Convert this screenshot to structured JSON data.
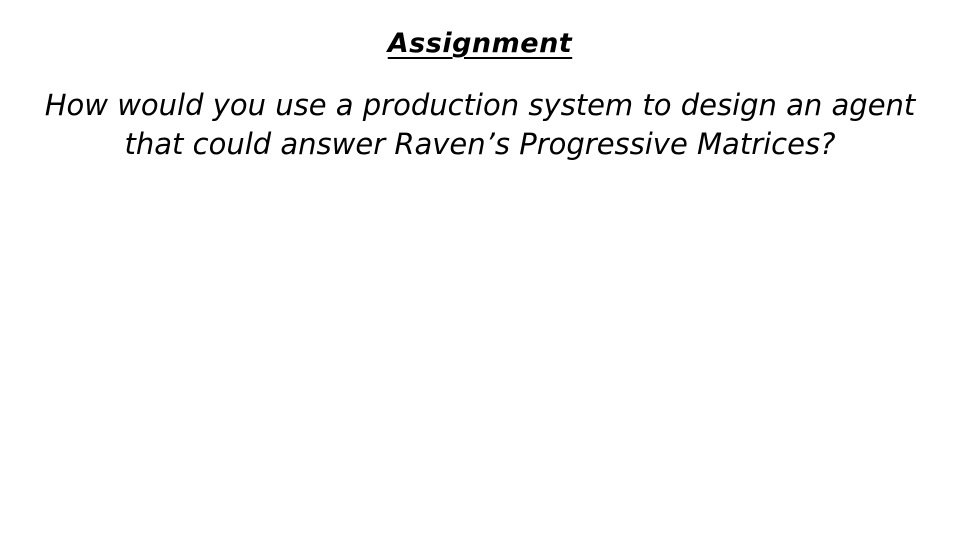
{
  "slide": {
    "title": "Assignment",
    "body": "How would you use a production system to design an agent that could answer Raven’s Progressive Matrices?"
  }
}
